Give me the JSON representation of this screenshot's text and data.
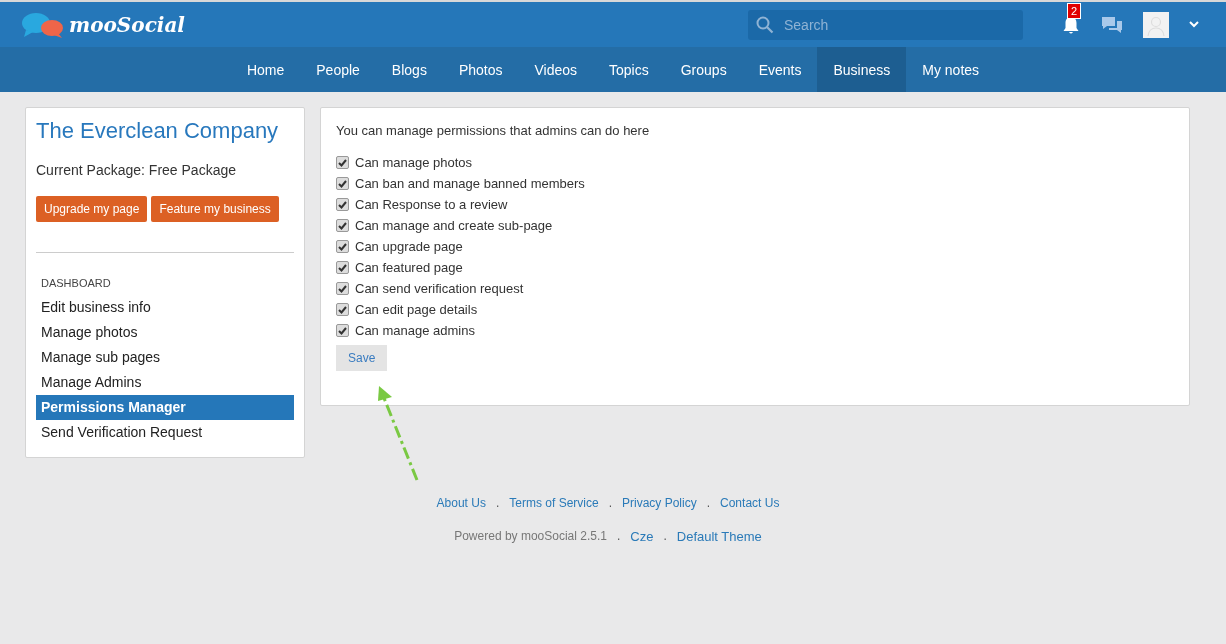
{
  "header": {
    "logo": "mooSocial",
    "search": {
      "placeholder": "Search"
    },
    "notification_count": "2"
  },
  "nav": [
    {
      "label": "Home",
      "selected": false
    },
    {
      "label": "People",
      "selected": false
    },
    {
      "label": "Blogs",
      "selected": false
    },
    {
      "label": "Photos",
      "selected": false
    },
    {
      "label": "Videos",
      "selected": false
    },
    {
      "label": "Topics",
      "selected": false
    },
    {
      "label": "Groups",
      "selected": false
    },
    {
      "label": "Events",
      "selected": false
    },
    {
      "label": "Business",
      "selected": true
    },
    {
      "label": "My notes",
      "selected": false
    }
  ],
  "sidebar": {
    "title": "The Everclean Company",
    "package": "Current Package: Free Package",
    "buttons": [
      "Upgrade my page",
      "Feature my business"
    ],
    "section": "DASHBOARD",
    "items": [
      {
        "label": "Edit business info",
        "selected": false
      },
      {
        "label": "Manage photos",
        "selected": false
      },
      {
        "label": "Manage sub pages",
        "selected": false
      },
      {
        "label": "Manage Admins",
        "selected": false
      },
      {
        "label": "Permissions Manager",
        "selected": true
      },
      {
        "label": "Send Verification Request",
        "selected": false
      }
    ]
  },
  "main": {
    "intro": "You can manage permissions that admins can do here",
    "permissions": [
      {
        "label": "Can manage photos",
        "checked": true
      },
      {
        "label": "Can ban and manage banned members",
        "checked": true
      },
      {
        "label": "Can Response to a review",
        "checked": true
      },
      {
        "label": "Can manage and create sub-page",
        "checked": true
      },
      {
        "label": "Can upgrade page",
        "checked": true
      },
      {
        "label": "Can featured page",
        "checked": true
      },
      {
        "label": "Can send verification request",
        "checked": true
      },
      {
        "label": "Can edit page details",
        "checked": true
      },
      {
        "label": "Can manage admins",
        "checked": true
      }
    ],
    "save_button": "Save"
  },
  "footer": {
    "links": [
      "About Us",
      ".",
      "Terms of Service",
      ".",
      "Privacy Policy",
      ".",
      "Contact Us"
    ],
    "powered": "Powered by mooSocial 2.5.1",
    "extra": [
      ".",
      "Cze",
      ".",
      "Default Theme"
    ]
  }
}
